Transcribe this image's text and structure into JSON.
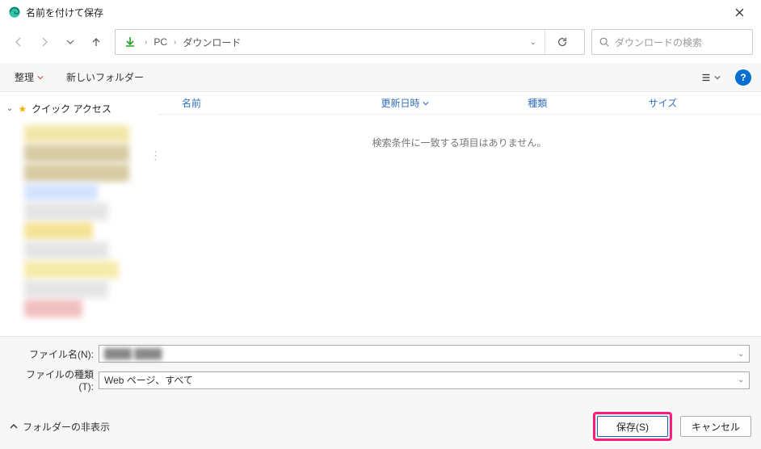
{
  "titlebar": {
    "title": "名前を付けて保存"
  },
  "nav": {
    "crumb_root": "PC",
    "crumb_folder": "ダウンロード"
  },
  "search": {
    "placeholder": "ダウンロードの検索"
  },
  "toolbar": {
    "organize": "整理",
    "newfolder": "新しいフォルダー"
  },
  "sidebar": {
    "quick_access": "クイック アクセス"
  },
  "columns": {
    "name": "名前",
    "date": "更新日時",
    "type": "種類",
    "size": "サイズ"
  },
  "list": {
    "empty": "検索条件に一致する項目はありません。"
  },
  "bottom": {
    "filename_label": "ファイル名(N):",
    "filetype_label": "ファイルの種類(T):",
    "filetype_value": "Web ページ、すべて"
  },
  "footer": {
    "hide_folders": "フォルダーの非表示",
    "save": "保存(S)",
    "cancel": "キャンセル"
  }
}
